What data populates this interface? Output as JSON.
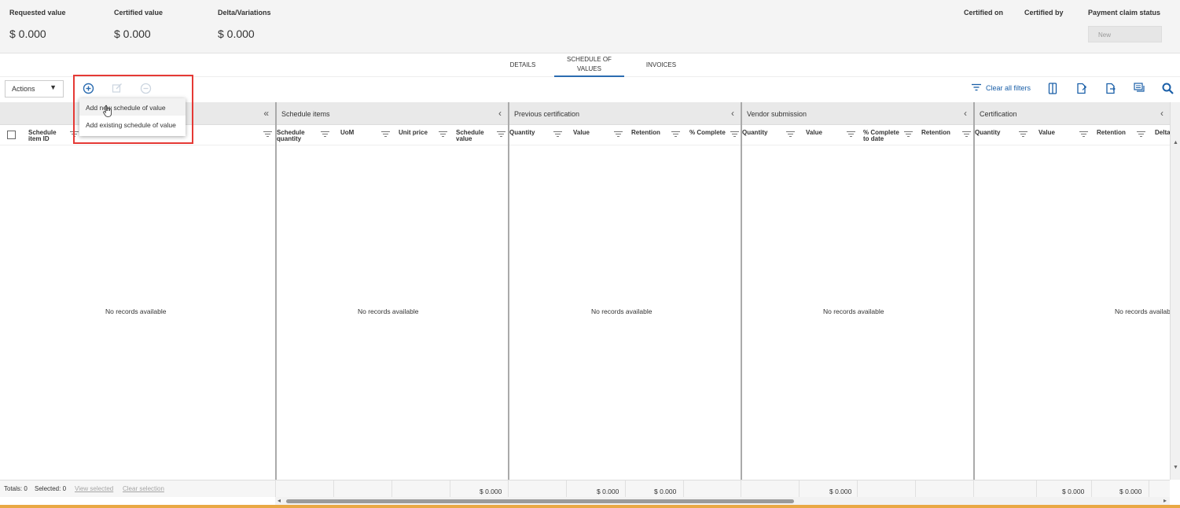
{
  "summary": {
    "requested": {
      "label": "Requested value",
      "value": "$ 0.000"
    },
    "certified": {
      "label": "Certified value",
      "value": "$ 0.000"
    },
    "delta": {
      "label": "Delta/Variations",
      "value": "$ 0.000"
    },
    "certified_on": {
      "label": "Certified on"
    },
    "certified_by": {
      "label": "Certified by"
    },
    "payment_status": {
      "label": "Payment claim status",
      "value": "New"
    }
  },
  "tabs": [
    {
      "label": "DETAILS"
    },
    {
      "label": "SCHEDULE OF\nVALUES",
      "active": true
    },
    {
      "label": "INVOICES"
    }
  ],
  "toolbar": {
    "actions_label": "Actions",
    "clear_filters": "Clear all filters",
    "icons": [
      "add-circle-icon",
      "edit-icon",
      "remove-circle-icon",
      "filter-lines-icon",
      "columns-icon",
      "export-icon",
      "export-alt-icon",
      "comments-icon",
      "search-icon"
    ]
  },
  "dropdown": {
    "items": [
      "Add new schedule of value",
      "Add existing schedule of value"
    ]
  },
  "grid": {
    "empty_text": "No records available",
    "panels": [
      {
        "title": "",
        "columns": [
          "Schedule\nitem ID"
        ]
      },
      {
        "title": "Schedule items",
        "columns": [
          "Schedule\nquantity",
          "UoM",
          "Unit price",
          "Schedule\nvalue"
        ]
      },
      {
        "title": "Previous certification",
        "columns": [
          "Quantity",
          "Value",
          "Retention",
          "% Complete"
        ]
      },
      {
        "title": "Vendor submission",
        "columns": [
          "Quantity",
          "Value",
          "% Complete\nto date",
          "Retention"
        ]
      },
      {
        "title": "Certification",
        "columns": [
          "Quantity",
          "Value",
          "Retention",
          "Delta"
        ]
      }
    ]
  },
  "footer": {
    "totals": "Totals: 0",
    "selected": "Selected: 0",
    "view_selected": "View selected",
    "clear_selection": "Clear selection",
    "schedule_value_total": "$ 0.000",
    "prev_value_total": "$ 0.000",
    "prev_retention_total": "$ 0.000",
    "vendor_value_total": "$ 0.000",
    "cert_value_total": "$ 0.000",
    "cert_retention_total": "$ 0.000"
  },
  "colors": {
    "accent": "#2b6cb0",
    "highlight": "#e53935",
    "bottom_bar": "#e9a844"
  }
}
